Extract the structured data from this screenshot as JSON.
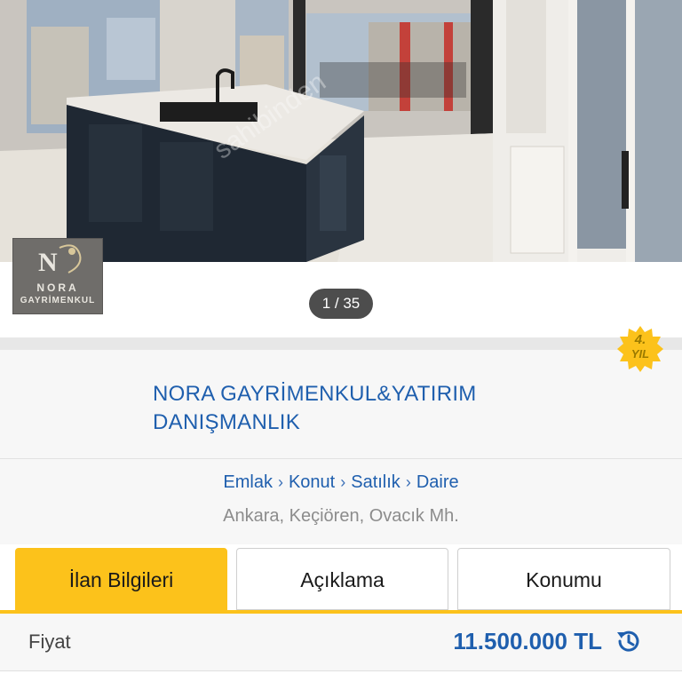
{
  "gallery": {
    "counter": "1 / 35",
    "watermark": "sahibinden",
    "logo": {
      "line1": "NORA",
      "line2": "GAYRİMENKUL"
    }
  },
  "store": {
    "name": "NORA GAYRİMENKUL&YATIRIM DANIŞMANLIK",
    "badge_number": "4.",
    "badge_label": "YIL"
  },
  "breadcrumb": [
    "Emlak",
    "Konut",
    "Satılık",
    "Daire"
  ],
  "location": "Ankara, Keçiören, Ovacık Mh.",
  "tabs": [
    {
      "label": "İlan Bilgileri",
      "active": true
    },
    {
      "label": "Açıklama",
      "active": false
    },
    {
      "label": "Konumu",
      "active": false
    }
  ],
  "price": {
    "label": "Fiyat",
    "value": "11.500.000 TL"
  },
  "colors": {
    "accent": "#fcc21b",
    "link": "#1f5fae",
    "muted": "#8c8c8c"
  },
  "icons": [
    "chevron-right-icon",
    "history-icon",
    "badge-star-icon"
  ]
}
